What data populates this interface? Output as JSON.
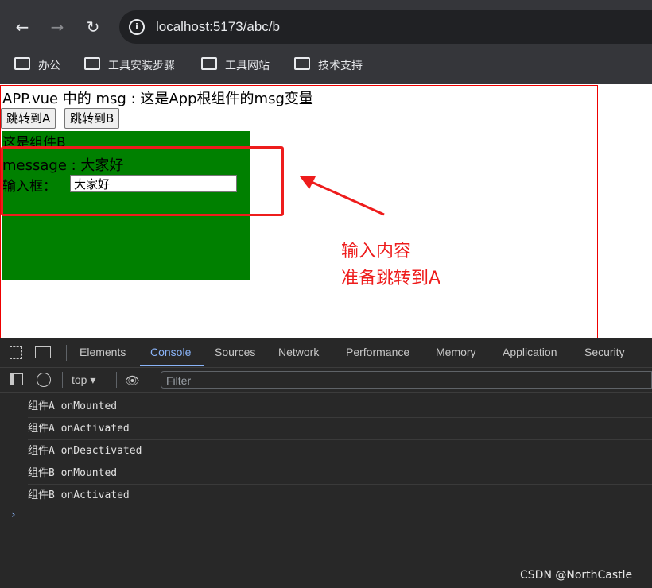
{
  "browser": {
    "url": "localhost:5173/abc/b",
    "bookmarks": [
      "办公",
      "工具安装步骤",
      "工具网站",
      "技术支持"
    ]
  },
  "page": {
    "app_msg": "APP.vue 中的 msg : 这是App根组件的msg变量",
    "buttons": [
      "跳转到A",
      "跳转到B"
    ],
    "component_title": "这是组件B",
    "message_text": "message : 大家好",
    "input_label": "输入框：",
    "input_value": "大家好",
    "annotation_line1": "输入内容",
    "annotation_line2": "准备跳转到A"
  },
  "devtools": {
    "tabs": [
      "Elements",
      "Console",
      "Sources",
      "Network",
      "Performance",
      "Memory",
      "Application",
      "Security"
    ],
    "active_tab": "Console",
    "context": "top",
    "filter_placeholder": "Filter",
    "logs": [
      "组件A onMounted",
      "组件A onActivated",
      "组件A onDeactivated",
      "组件B onMounted",
      "组件B onActivated"
    ],
    "prompt": "›"
  },
  "watermark": "CSDN @NorthCastle",
  "colors": {
    "component_bg": "#008000",
    "annotation": "#ee1c1c",
    "accent": "#8ab4f8"
  },
  "icons": [
    "back-icon",
    "forward-icon",
    "reload-icon",
    "info-icon",
    "folder-icon",
    "inspect-icon",
    "device-icon",
    "sidebar-icon",
    "clear-icon",
    "eye-icon"
  ]
}
